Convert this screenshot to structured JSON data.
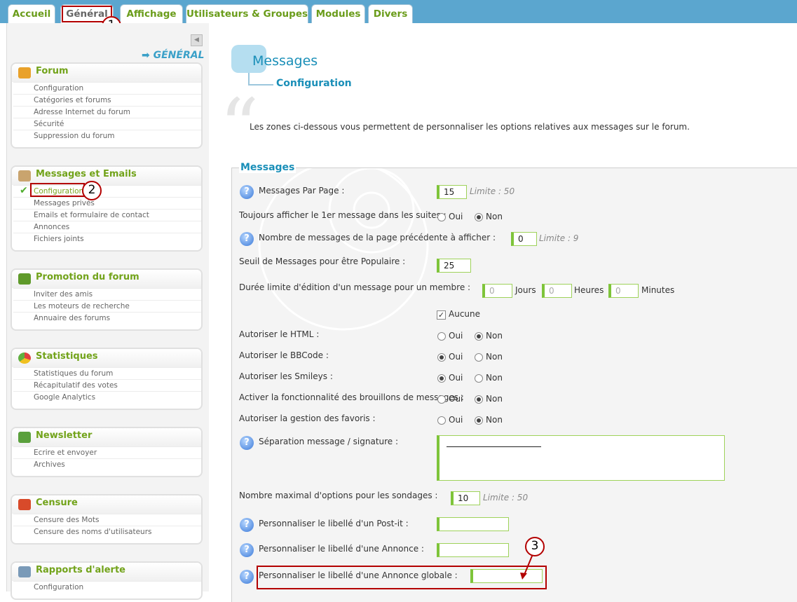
{
  "tabs": [
    {
      "label": "Accueil"
    },
    {
      "label": "Général"
    },
    {
      "label": "Affichage"
    },
    {
      "label": "Utilisateurs & Groupes"
    },
    {
      "label": "Modules"
    },
    {
      "label": "Divers"
    }
  ],
  "sidebar": {
    "section_link": "➡ GÉNÉRAL",
    "boxes": [
      {
        "title": "Forum",
        "icon": "wrench-key-icon",
        "items": [
          "Configuration",
          "Catégories et forums",
          "Adresse Internet du forum",
          "Sécurité",
          "Suppression du forum"
        ]
      },
      {
        "title": "Messages et Emails",
        "icon": "messages-icon",
        "items": [
          "Configuration",
          "Messages privés",
          "Emails et formulaire de contact",
          "Annonces",
          "Fichiers joints"
        ]
      },
      {
        "title": "Promotion du forum",
        "icon": "megaphone-icon",
        "items": [
          "Inviter des amis",
          "Les moteurs de recherche",
          "Annuaire des forums"
        ]
      },
      {
        "title": "Statistiques",
        "icon": "pie-chart-icon",
        "items": [
          "Statistiques du forum",
          "Récapitulatif des votes",
          "Google Analytics"
        ]
      },
      {
        "title": "Newsletter",
        "icon": "newsletter-icon",
        "items": [
          "Ecrire et envoyer",
          "Archives"
        ]
      },
      {
        "title": "Censure",
        "icon": "censure-icon",
        "items": [
          "Censure des Mots",
          "Censure des noms d'utilisateurs"
        ]
      },
      {
        "title": "Rapports d'alerte",
        "icon": "report-icon",
        "items": [
          "Configuration"
        ]
      }
    ]
  },
  "annotations": [
    "1",
    "2",
    "3"
  ],
  "main": {
    "title": "Messages",
    "subtitle": "Configuration",
    "description": "Les zones ci-dessous vous permettent de personnaliser les options relatives aux messages sur le forum.",
    "fieldset_legend": "Messages",
    "fields": {
      "per_page": {
        "label": "Messages Par Page :",
        "value": "15",
        "limit": "Limite : 50"
      },
      "always_first": {
        "label": "Toujours afficher le 1er message dans les suites :"
      },
      "prev_msgs": {
        "label": "Nombre de messages de la page précédente à afficher :",
        "value": "0",
        "limit": "Limite : 9"
      },
      "popular": {
        "label": "Seuil de Messages pour être Populaire :",
        "value": "25"
      },
      "edit_limit": {
        "label": "Durée limite d'édition d'un message pour un membre :",
        "days": "0",
        "days_label": "Jours",
        "hours": "0",
        "hours_label": "Heures",
        "minutes": "0",
        "minutes_label": "Minutes",
        "none_label": "Aucune"
      },
      "html": {
        "label": "Autoriser le HTML :"
      },
      "bbcode": {
        "label": "Autoriser le BBCode :"
      },
      "smileys": {
        "label": "Autoriser les Smileys :"
      },
      "drafts": {
        "label": "Activer la fonctionnalité des brouillons de messages :"
      },
      "favorites": {
        "label": "Autoriser la gestion des favoris :"
      },
      "separator": {
        "label": "Séparation message / signature :"
      },
      "poll_options": {
        "label": "Nombre maximal d'options pour les sondages :",
        "value": "10",
        "limit": "Limite : 50"
      },
      "postit_label": {
        "label": "Personnaliser le libellé d'un Post-it :"
      },
      "announce_label": {
        "label": "Personnaliser le libellé d'une Annonce :"
      },
      "global_announce_label": {
        "label": "Personnaliser le libellé d'une Annonce globale :"
      }
    },
    "yes": "Oui",
    "no": "Non"
  }
}
